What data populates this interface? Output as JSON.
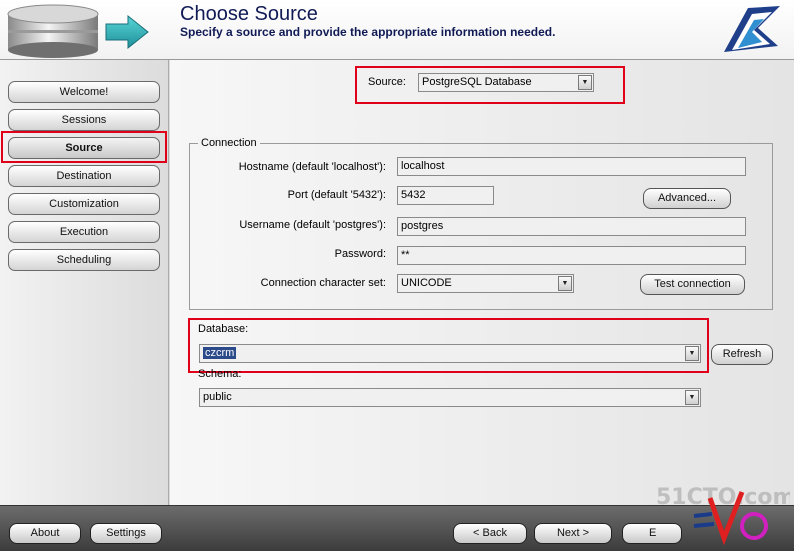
{
  "header": {
    "title": "Choose Source",
    "subtitle": "Specify a source and provide the appropriate information needed."
  },
  "sidebar": {
    "items": [
      {
        "label": "Welcome!"
      },
      {
        "label": "Sessions"
      },
      {
        "label": "Source",
        "active": true
      },
      {
        "label": "Destination"
      },
      {
        "label": "Customization"
      },
      {
        "label": "Execution"
      },
      {
        "label": "Scheduling"
      }
    ]
  },
  "source": {
    "label": "Source:",
    "value": "PostgreSQL Database"
  },
  "connection": {
    "legend": "Connection",
    "hostname_label": "Hostname (default 'localhost'):",
    "hostname_value": "localhost",
    "port_label": "Port (default '5432'):",
    "port_value": "5432",
    "advanced_label": "Advanced...",
    "username_label": "Username (default 'postgres'):",
    "username_value": "postgres",
    "password_label": "Password:",
    "password_value": "**",
    "charset_label": "Connection character set:",
    "charset_value": "UNICODE",
    "test_label": "Test connection"
  },
  "database": {
    "label": "Database:",
    "value": "czcrm",
    "refresh_label": "Refresh"
  },
  "schema": {
    "label": "Schema:",
    "value": "public"
  },
  "footer": {
    "about_label": "About",
    "settings_label": "Settings",
    "back_label": "< Back",
    "next_label": "Next >",
    "exit_label": "E"
  },
  "watermark": {
    "site": "51CTO.com"
  },
  "colors": {
    "highlight": "#e0001a",
    "title": "#101a55"
  }
}
